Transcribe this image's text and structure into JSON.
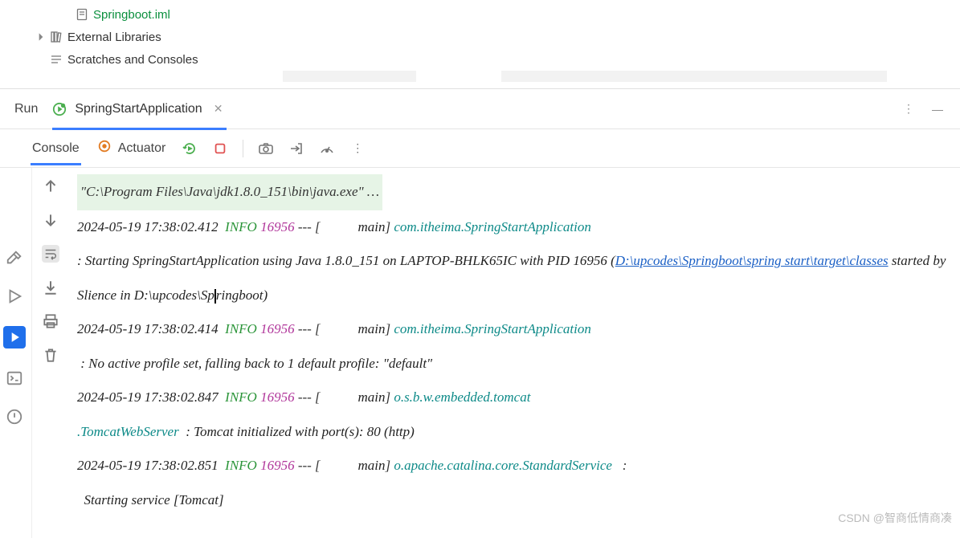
{
  "tree": {
    "file_iml": "Springboot.iml",
    "external_libs": "External Libraries",
    "scratches": "Scratches and Consoles"
  },
  "run": {
    "label": "Run",
    "tab_name": "SpringStartApplication"
  },
  "console_tabs": {
    "console": "Console",
    "actuator": "Actuator"
  },
  "cmd": "\"C:\\Program Files\\Java\\jdk1.8.0_151\\bin\\java.exe\" …",
  "logs": [
    {
      "ts": "2024-05-19 17:38:02.412",
      "level": "INFO",
      "pid": "16956",
      "thread": "main",
      "logger": "com.itheima.SpringStartApplication",
      "msg_pre": " : Starting SpringStartApplication using Java 1.8.0_151 on LAPTOP-BHLK65IC with PID 16956 (",
      "link": "D:\\upcodes\\Springboot\\spring start\\target\\classes",
      "msg_post": " started by Slience in D:\\upcodes\\Springboot)"
    },
    {
      "ts": "2024-05-19 17:38:02.414",
      "level": "INFO",
      "pid": "16956",
      "thread": "main",
      "logger": "com.itheima.SpringStartApplication",
      "msg": " : No active profile set, falling back to 1 default profile: \"default\""
    },
    {
      "ts": "2024-05-19 17:38:02.847",
      "level": "INFO",
      "pid": "16956",
      "thread": "main",
      "logger": "o.s.b.w.embedded.tomcat",
      "logger2": ".TomcatWebServer",
      "msg": "  : Tomcat initialized with port(s): 80 (http)"
    },
    {
      "ts": "2024-05-19 17:38:02.851",
      "level": "INFO",
      "pid": "16956",
      "thread": "main",
      "logger": "o.apache.catalina.core.StandardService",
      "msg": "Starting service [Tomcat]"
    }
  ],
  "watermark": "CSDN @智商低情商凑"
}
